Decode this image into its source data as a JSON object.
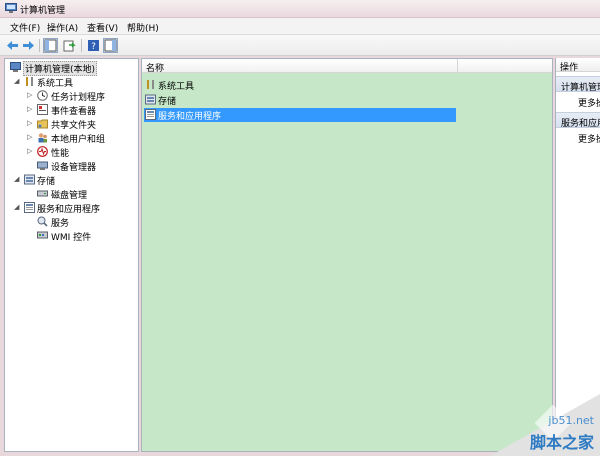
{
  "window": {
    "title": "计算机管理"
  },
  "menu": {
    "items": [
      "文件(F)",
      "操作(A)",
      "查看(V)",
      "帮助(H)"
    ]
  },
  "tree": {
    "items": [
      {
        "label": "计算机管理(本地)",
        "icon": "computer-management-icon",
        "arrow": ""
      },
      {
        "label": "系统工具",
        "icon": "tools-icon",
        "arrow": "expanded"
      },
      {
        "label": "任务计划程序",
        "icon": "clock-icon",
        "arrow": "collapsed"
      },
      {
        "label": "事件查看器",
        "icon": "event-viewer-icon",
        "arrow": "collapsed"
      },
      {
        "label": "共享文件夹",
        "icon": "shared-folder-icon",
        "arrow": "collapsed"
      },
      {
        "label": "本地用户和组",
        "icon": "users-icon",
        "arrow": "collapsed"
      },
      {
        "label": "性能",
        "icon": "performance-icon",
        "arrow": "collapsed"
      },
      {
        "label": "设备管理器",
        "icon": "device-manager-icon",
        "arrow": ""
      },
      {
        "label": "存储",
        "icon": "storage-icon",
        "arrow": "expanded"
      },
      {
        "label": "磁盘管理",
        "icon": "disk-icon",
        "arrow": ""
      },
      {
        "label": "服务和应用程序",
        "icon": "services-apps-icon",
        "arrow": "expanded"
      },
      {
        "label": "服务",
        "icon": "services-icon",
        "arrow": ""
      },
      {
        "label": "WMI 控件",
        "icon": "wmi-icon",
        "arrow": ""
      }
    ]
  },
  "list": {
    "column_name": "名称",
    "items": [
      {
        "label": "系统工具",
        "icon": "tools-icon"
      },
      {
        "label": "存储",
        "icon": "storage-icon"
      },
      {
        "label": "服务和应用程序",
        "icon": "services-apps-icon"
      }
    ]
  },
  "actions": {
    "header": "操作",
    "sections": [
      {
        "title": "计算机管理",
        "link": "更多操作"
      },
      {
        "title": "服务和应用程序",
        "link": "更多操作"
      }
    ]
  },
  "watermark": {
    "url": "jb51.net",
    "name": "脚本之家"
  },
  "colors": {
    "selection": "#3399ff",
    "content_bg": "#c6e8c8"
  }
}
